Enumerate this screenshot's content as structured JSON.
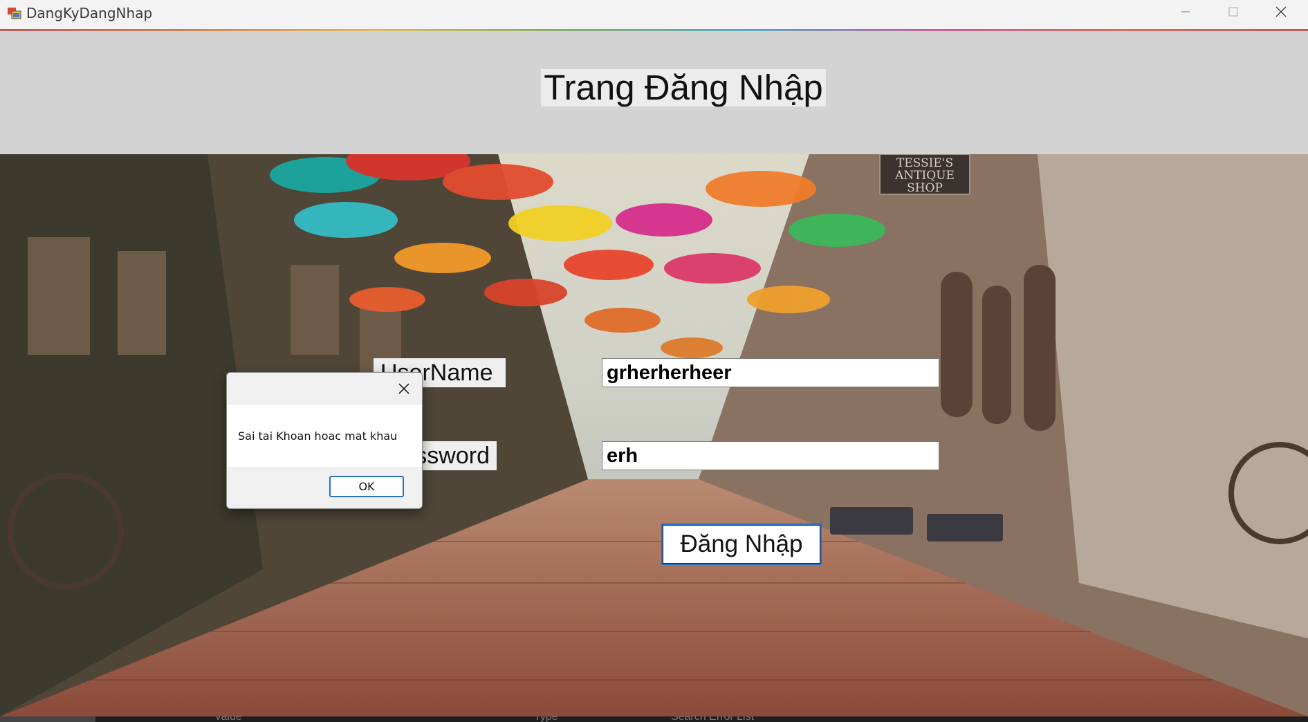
{
  "window": {
    "title": "DangKyDangNhap",
    "controls": {
      "minimize_icon": "minimize-icon",
      "maximize_icon": "maximize-icon",
      "close_icon": "close-icon"
    }
  },
  "header": {
    "title": "Trang Đăng Nhập"
  },
  "form": {
    "username_label": "UserName",
    "username_value": "grherherheer",
    "password_label": "Password",
    "password_value": "erh",
    "login_button": "Đăng Nhập"
  },
  "dialog": {
    "message": "Sai tai Khoan hoac mat khau",
    "ok_label": "OK"
  },
  "background_scene": {
    "shop_sign": [
      "TESSIE'S",
      "ANTIQUE",
      "SHOP"
    ]
  },
  "bottom_bar": {
    "items": [
      "Value",
      "Type",
      "Search Error List"
    ]
  },
  "colors": {
    "accent": "#2e6fc0",
    "header_bg": "#d3d3d3",
    "label_bg": "#efefef"
  }
}
